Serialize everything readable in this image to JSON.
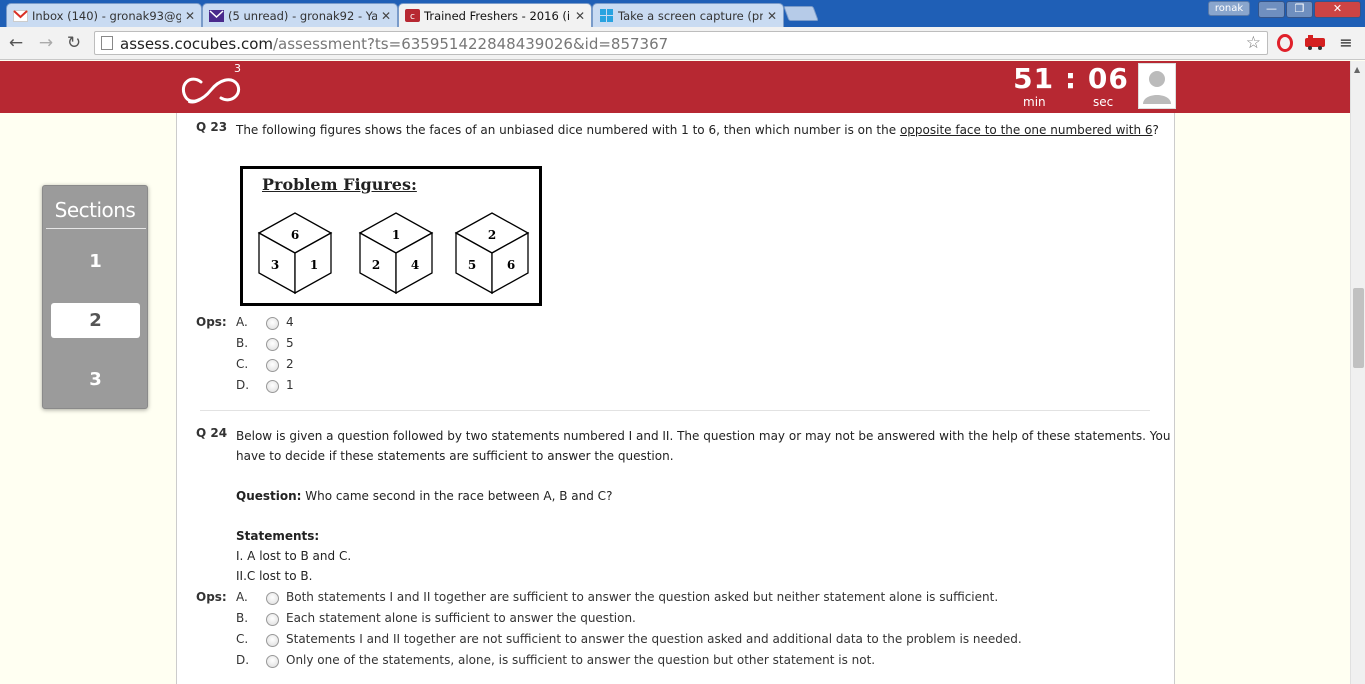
{
  "browser": {
    "tabs": [
      {
        "title": "Inbox (140) - gronak93@g",
        "icon": "gmail-icon",
        "active": false
      },
      {
        "title": "(5 unread) - gronak92 - Ya",
        "icon": "yahoo-mail-icon",
        "active": false
      },
      {
        "title": "Trained Freshers - 2016 (i",
        "icon": "cocubes-icon",
        "active": true
      },
      {
        "title": "Take a screen capture (pri",
        "icon": "windows-icon",
        "active": false
      }
    ],
    "profile_name": "ronak",
    "url_host": "assess.cocubes.com",
    "url_path": "/assessment?ts=635951422848439026&id=857367"
  },
  "header": {
    "logo_superscript": "3",
    "timer_min": "51",
    "timer_sep": ":",
    "timer_sec": "06",
    "min_label": "min",
    "sec_label": "sec"
  },
  "sections": {
    "title": "Sections",
    "items": [
      "1",
      "2",
      "3"
    ],
    "active": "2"
  },
  "q23": {
    "number": "Q 23",
    "text_before": "The following figures shows the faces of an unbiased dice numbered with 1 to 6, then which number is on the ",
    "text_underlined": "opposite face to the one numbered with 6",
    "text_after": "?",
    "figure_title": "Problem Figures:",
    "dice": [
      {
        "top": "6",
        "left": "3",
        "right": "1"
      },
      {
        "top": "1",
        "left": "2",
        "right": "4"
      },
      {
        "top": "2",
        "left": "5",
        "right": "6"
      }
    ],
    "ops_label": "Ops:",
    "options": [
      {
        "letter": "A.",
        "text": "4"
      },
      {
        "letter": "B.",
        "text": "5"
      },
      {
        "letter": "C.",
        "text": "2"
      },
      {
        "letter": "D.",
        "text": "1"
      }
    ]
  },
  "q24": {
    "number": "Q 24",
    "text_line1": "Below is given a question followed by two statements numbered I and II. The question may or may not be answered with the help of these statements. You",
    "text_line2": "have to decide if these statements are sufficient to answer the question.",
    "question_label": "Question:",
    "question_text": " Who came second in the race between A, B and C?",
    "statements_label": "Statements:",
    "statement1": "I. A lost to B and C.",
    "statement2": "II.C lost to B.",
    "ops_label": "Ops:",
    "options": [
      {
        "letter": "A.",
        "text": "Both statements I and II together are sufficient to answer the question asked but neither statement alone is sufficient."
      },
      {
        "letter": "B.",
        "text": "Each statement alone is sufficient to answer the question."
      },
      {
        "letter": "C.",
        "text": "Statements I and II together are not sufficient to answer the question asked and additional data to the problem is needed."
      },
      {
        "letter": "D.",
        "text": "Only one of the statements, alone, is sufficient to answer the question but other statement is not."
      }
    ]
  }
}
